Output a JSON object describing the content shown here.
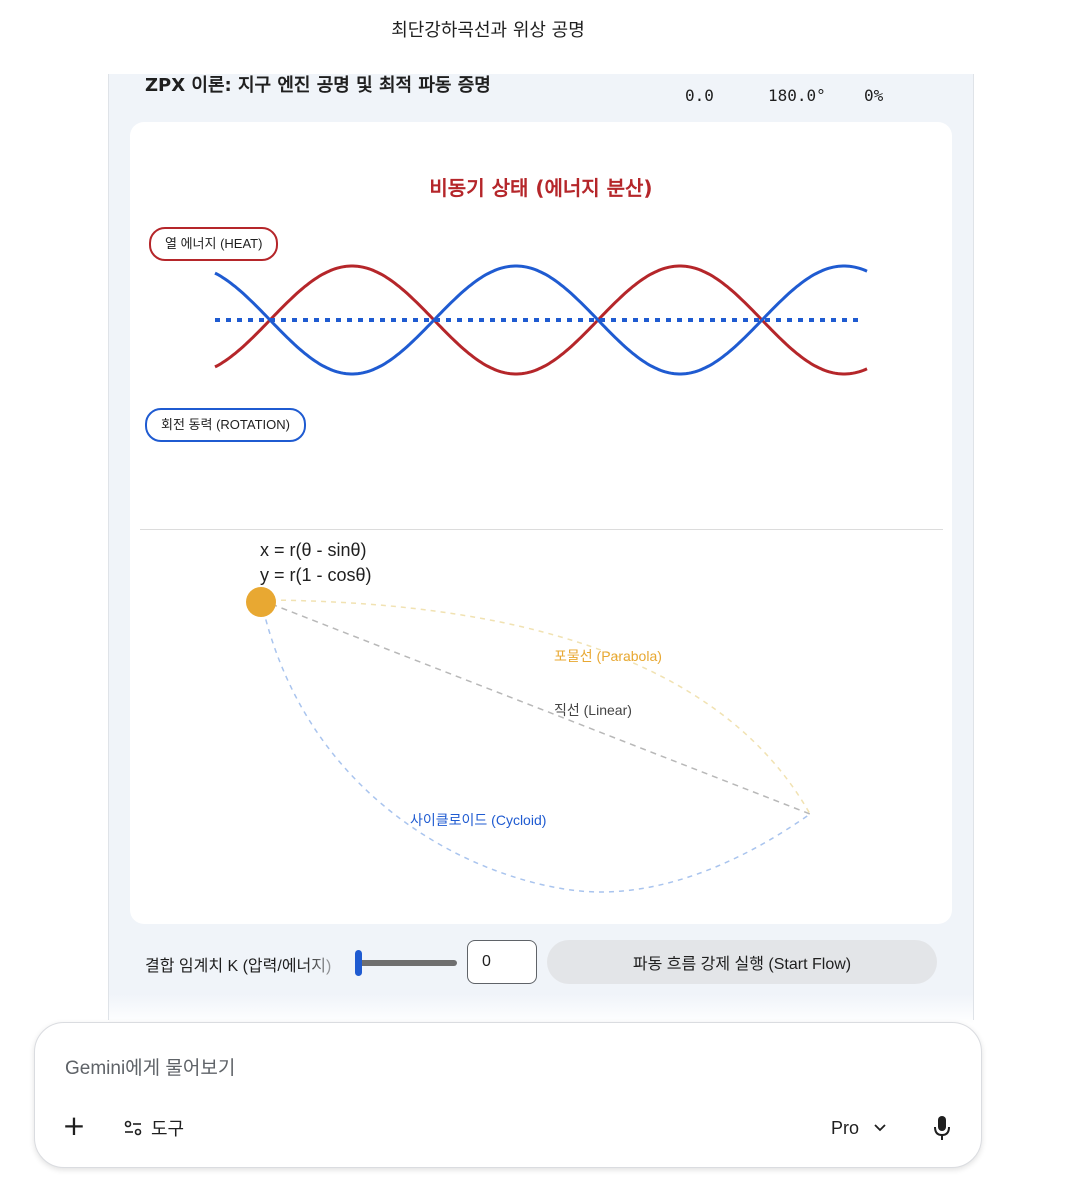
{
  "page_title": "최단강하곡선과 위상 공명",
  "app": {
    "heading": "ZPX 이론: 지구 엔진 공명 및 최적 파동 증명",
    "stats": [
      "0.0",
      "180.0°",
      "0%"
    ],
    "state_title": "비동기 상태 (에너지 분산)",
    "heat_label": "열 에너지 (HEAT)",
    "rotation_label": "회전 동력 (ROTATION)",
    "colors": {
      "heat": "#b5262a",
      "rotation": "#1f5bd1",
      "ball": "#e8a832",
      "parabola": "#e8a832",
      "linear": "#555555",
      "cycloid": "#1f5bd1"
    },
    "formula_x": "x = r(θ - sinθ)",
    "formula_y": "y = r(1 - cosθ)",
    "curve_labels": {
      "parabola": "포물선 (Parabola)",
      "linear": "직선 (Linear)",
      "cycloid": "사이클로이드 (Cycloid)"
    },
    "controls": {
      "k_label": "결합 임계치 K (압력/에너지)",
      "k_value": "0",
      "start_button": "파동 흐름 강제 실행 (Start Flow)"
    }
  },
  "composer": {
    "placeholder": "Gemini에게 물어보기",
    "tools_label": "도구",
    "model_label": "Pro",
    "icons": [
      "plus-icon",
      "tools-icon",
      "chevron-down-icon",
      "mic-icon"
    ]
  }
}
